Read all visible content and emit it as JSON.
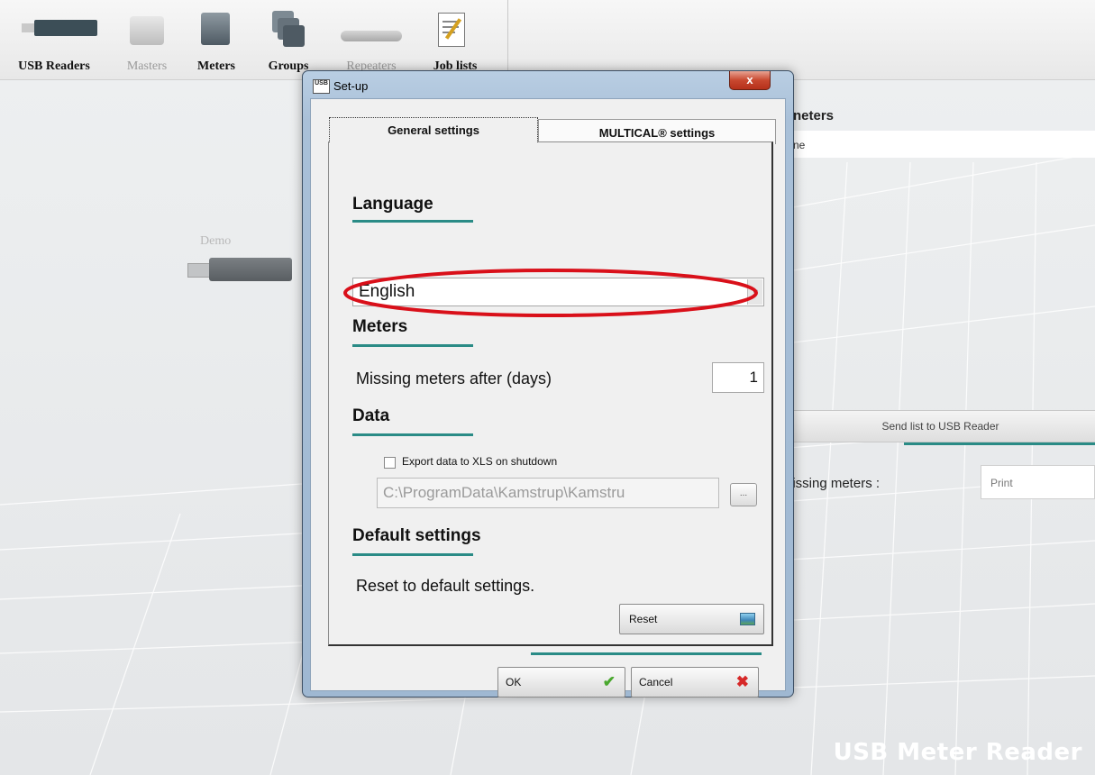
{
  "toolbar": {
    "items": [
      {
        "label": "USB Readers",
        "dim": false
      },
      {
        "label": "Masters",
        "dim": true
      },
      {
        "label": "Meters",
        "dim": false
      },
      {
        "label": "Groups",
        "dim": false
      },
      {
        "label": "Repeaters",
        "dim": true
      },
      {
        "label": "Job lists",
        "dim": false
      }
    ]
  },
  "left_area": {
    "demo_label": "Demo"
  },
  "right_panel": {
    "title_fragment": "neters",
    "line_fragment": "ne",
    "send_button": "Send list to USB Reader",
    "missing_label": "lissing meters :",
    "print_field": "Print"
  },
  "brand": "USB Meter Reader",
  "dialog": {
    "icon_text": "USB",
    "title": "Set-up",
    "close_symbol": "x",
    "tabs": [
      {
        "label": "General settings",
        "active": true
      },
      {
        "label": "MULTICAL® settings",
        "active": false
      }
    ],
    "language": {
      "heading": "Language",
      "selected": "English"
    },
    "meters": {
      "heading": "Meters",
      "missing_label": "Missing meters after (days)",
      "missing_value": "1"
    },
    "data": {
      "heading": "Data",
      "export_label": "Export data to XLS on shutdown",
      "export_checked": false,
      "path_value": "C:\\ProgramData\\Kamstrup\\Kamstru",
      "browse_label": "..."
    },
    "defaults": {
      "heading": "Default settings",
      "reset_text": "Reset to default settings.",
      "reset_button": "Reset"
    },
    "ok_button": "OK",
    "cancel_button": "Cancel"
  },
  "colors": {
    "accent_teal": "#2a8b86",
    "highlight_red": "#d9101a",
    "dialog_frame": "#a9c0d8"
  }
}
